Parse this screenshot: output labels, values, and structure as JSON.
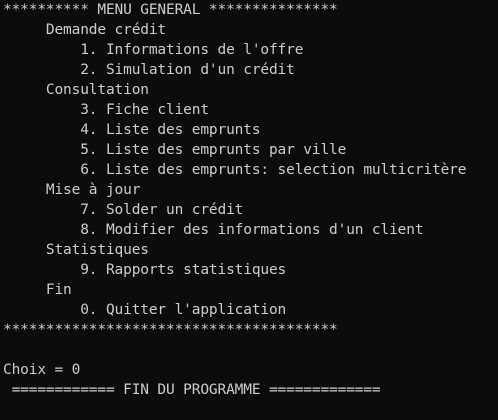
{
  "console": {
    "header_line": "********** MENU GENERAL ***************",
    "sections": [
      {
        "title": "     Demande crédit",
        "items": [
          "         1. Informations de l'offre",
          "         2. Simulation d'un crédit"
        ]
      },
      {
        "title": "     Consultation",
        "items": [
          "         3. Fiche client",
          "         4. Liste des emprunts",
          "         5. Liste des emprunts par ville",
          "         6. Liste des emprunts: selection multicritère"
        ]
      },
      {
        "title": "     Mise à jour",
        "items": [
          "         7. Solder un crédit",
          "         8. Modifier des informations d'un client"
        ]
      },
      {
        "title": "     Statistiques",
        "items": [
          "         9. Rapports statistiques"
        ]
      },
      {
        "title": "     Fin",
        "items": [
          "         0. Quitter l'application"
        ]
      }
    ],
    "footer_line": "***************************************",
    "choice_line": "Choix = 0",
    "end_line": " ============ FIN DU PROGRAMME ============="
  },
  "colors": {
    "background": "#0c0c0c",
    "text": "#cccccc"
  }
}
